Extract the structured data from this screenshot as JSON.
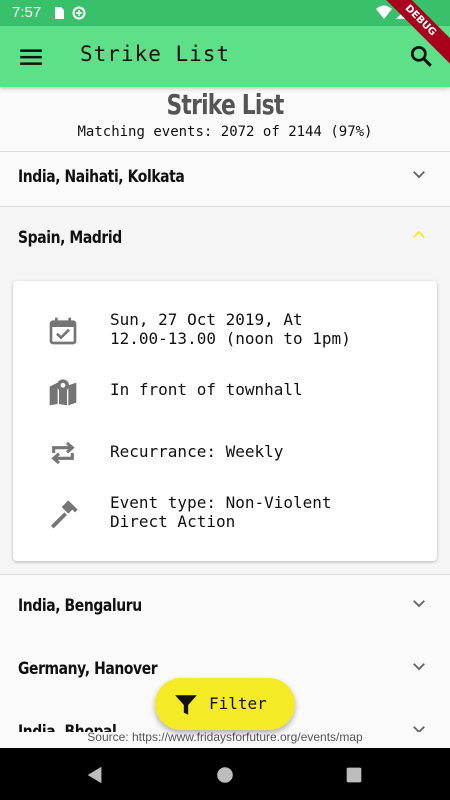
{
  "status_bar": {
    "time": "7:57",
    "icons": [
      "sd-card-icon",
      "data-saver-icon",
      "wifi-icon",
      "signal-icon",
      "battery-icon"
    ]
  },
  "debug_banner": "DEBUG",
  "app_bar": {
    "title": "Strike List",
    "menu_icon": "menu-icon",
    "search_icon": "search-icon"
  },
  "header": {
    "title": "Strike List",
    "matching_text": "Matching events: 2072 of 2144 (97%)"
  },
  "events": [
    {
      "label": "India, Naihati, Kolkata",
      "expanded": false
    },
    {
      "label": "Spain, Madrid",
      "expanded": true
    },
    {
      "label": "India, Bengaluru",
      "expanded": false
    },
    {
      "label": "Germany, Hanover",
      "expanded": false
    },
    {
      "label": "India, Bhopal",
      "expanded": false
    }
  ],
  "expanded_details": {
    "date": "Sun, 27 Oct 2019, At\n12.00-13.00 (noon to 1pm)",
    "location": "In front of townhall",
    "recurrance": "Recurrance: Weekly",
    "event_type": "Event type: Non-Violent\nDirect Action"
  },
  "colors": {
    "status_bar": "#39c06a",
    "app_bar": "#5de087",
    "fab": "#f4ea25",
    "expanded_chevron": "#f4ea25",
    "icon_gray": "#757575"
  },
  "fab": {
    "label": "Filter",
    "icon": "filter-icon"
  },
  "source": "Source: https://www.fridaysforfuture.org/events/map",
  "nav": [
    "back-icon",
    "home-icon",
    "recents-icon"
  ]
}
